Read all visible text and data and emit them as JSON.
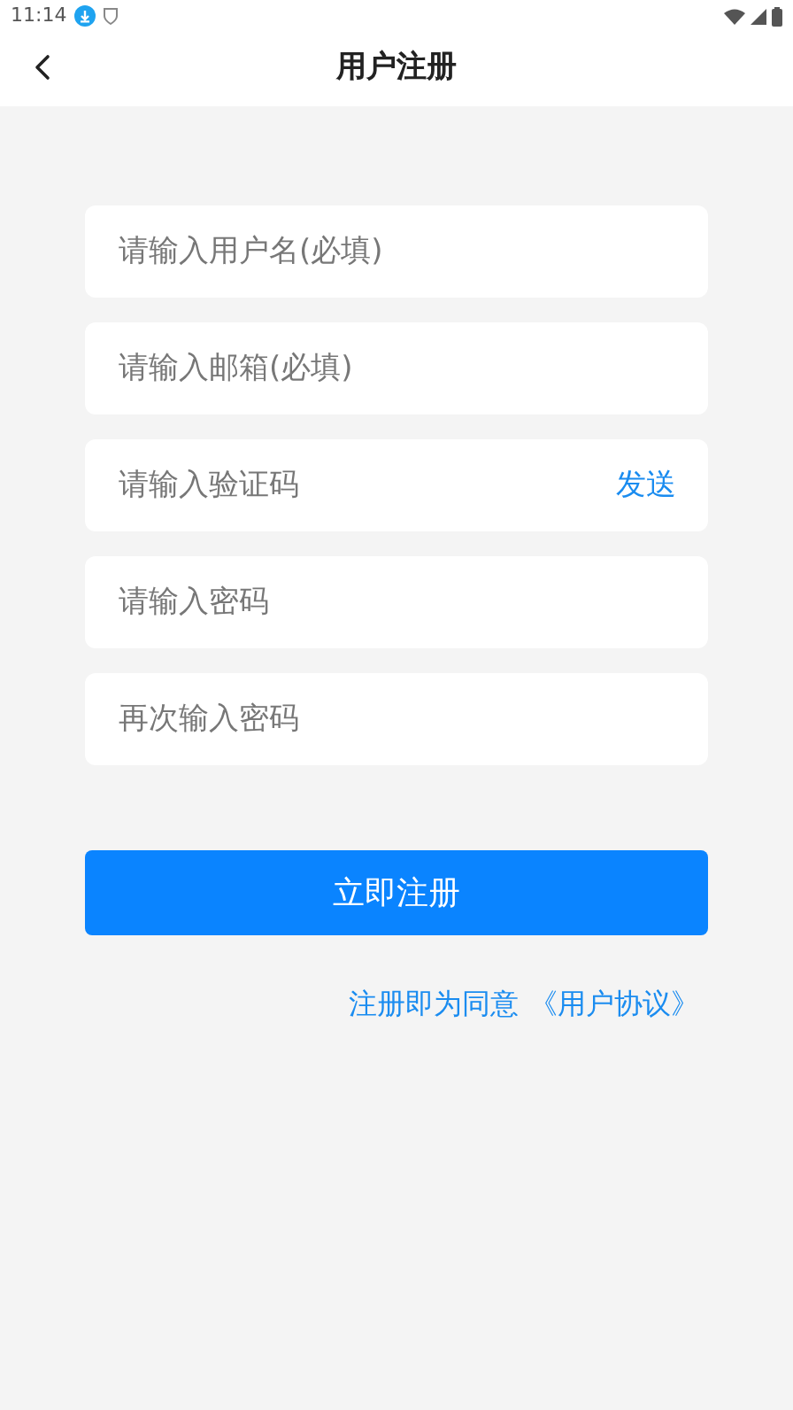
{
  "status_bar": {
    "time": "11:14"
  },
  "header": {
    "title": "用户注册"
  },
  "fields": [
    {
      "kind": "plain",
      "placeholder": "请输入用户名(必填)"
    },
    {
      "kind": "plain",
      "placeholder": "请输入邮箱(必填)"
    },
    {
      "kind": "code",
      "placeholder": "请输入验证码",
      "action": "发送"
    },
    {
      "kind": "password",
      "placeholder": "请输入密码"
    },
    {
      "kind": "password",
      "placeholder": "再次输入密码"
    }
  ],
  "submit": "立即注册",
  "agreement": {
    "text": "注册即为同意",
    "link": "《用户协议》"
  }
}
